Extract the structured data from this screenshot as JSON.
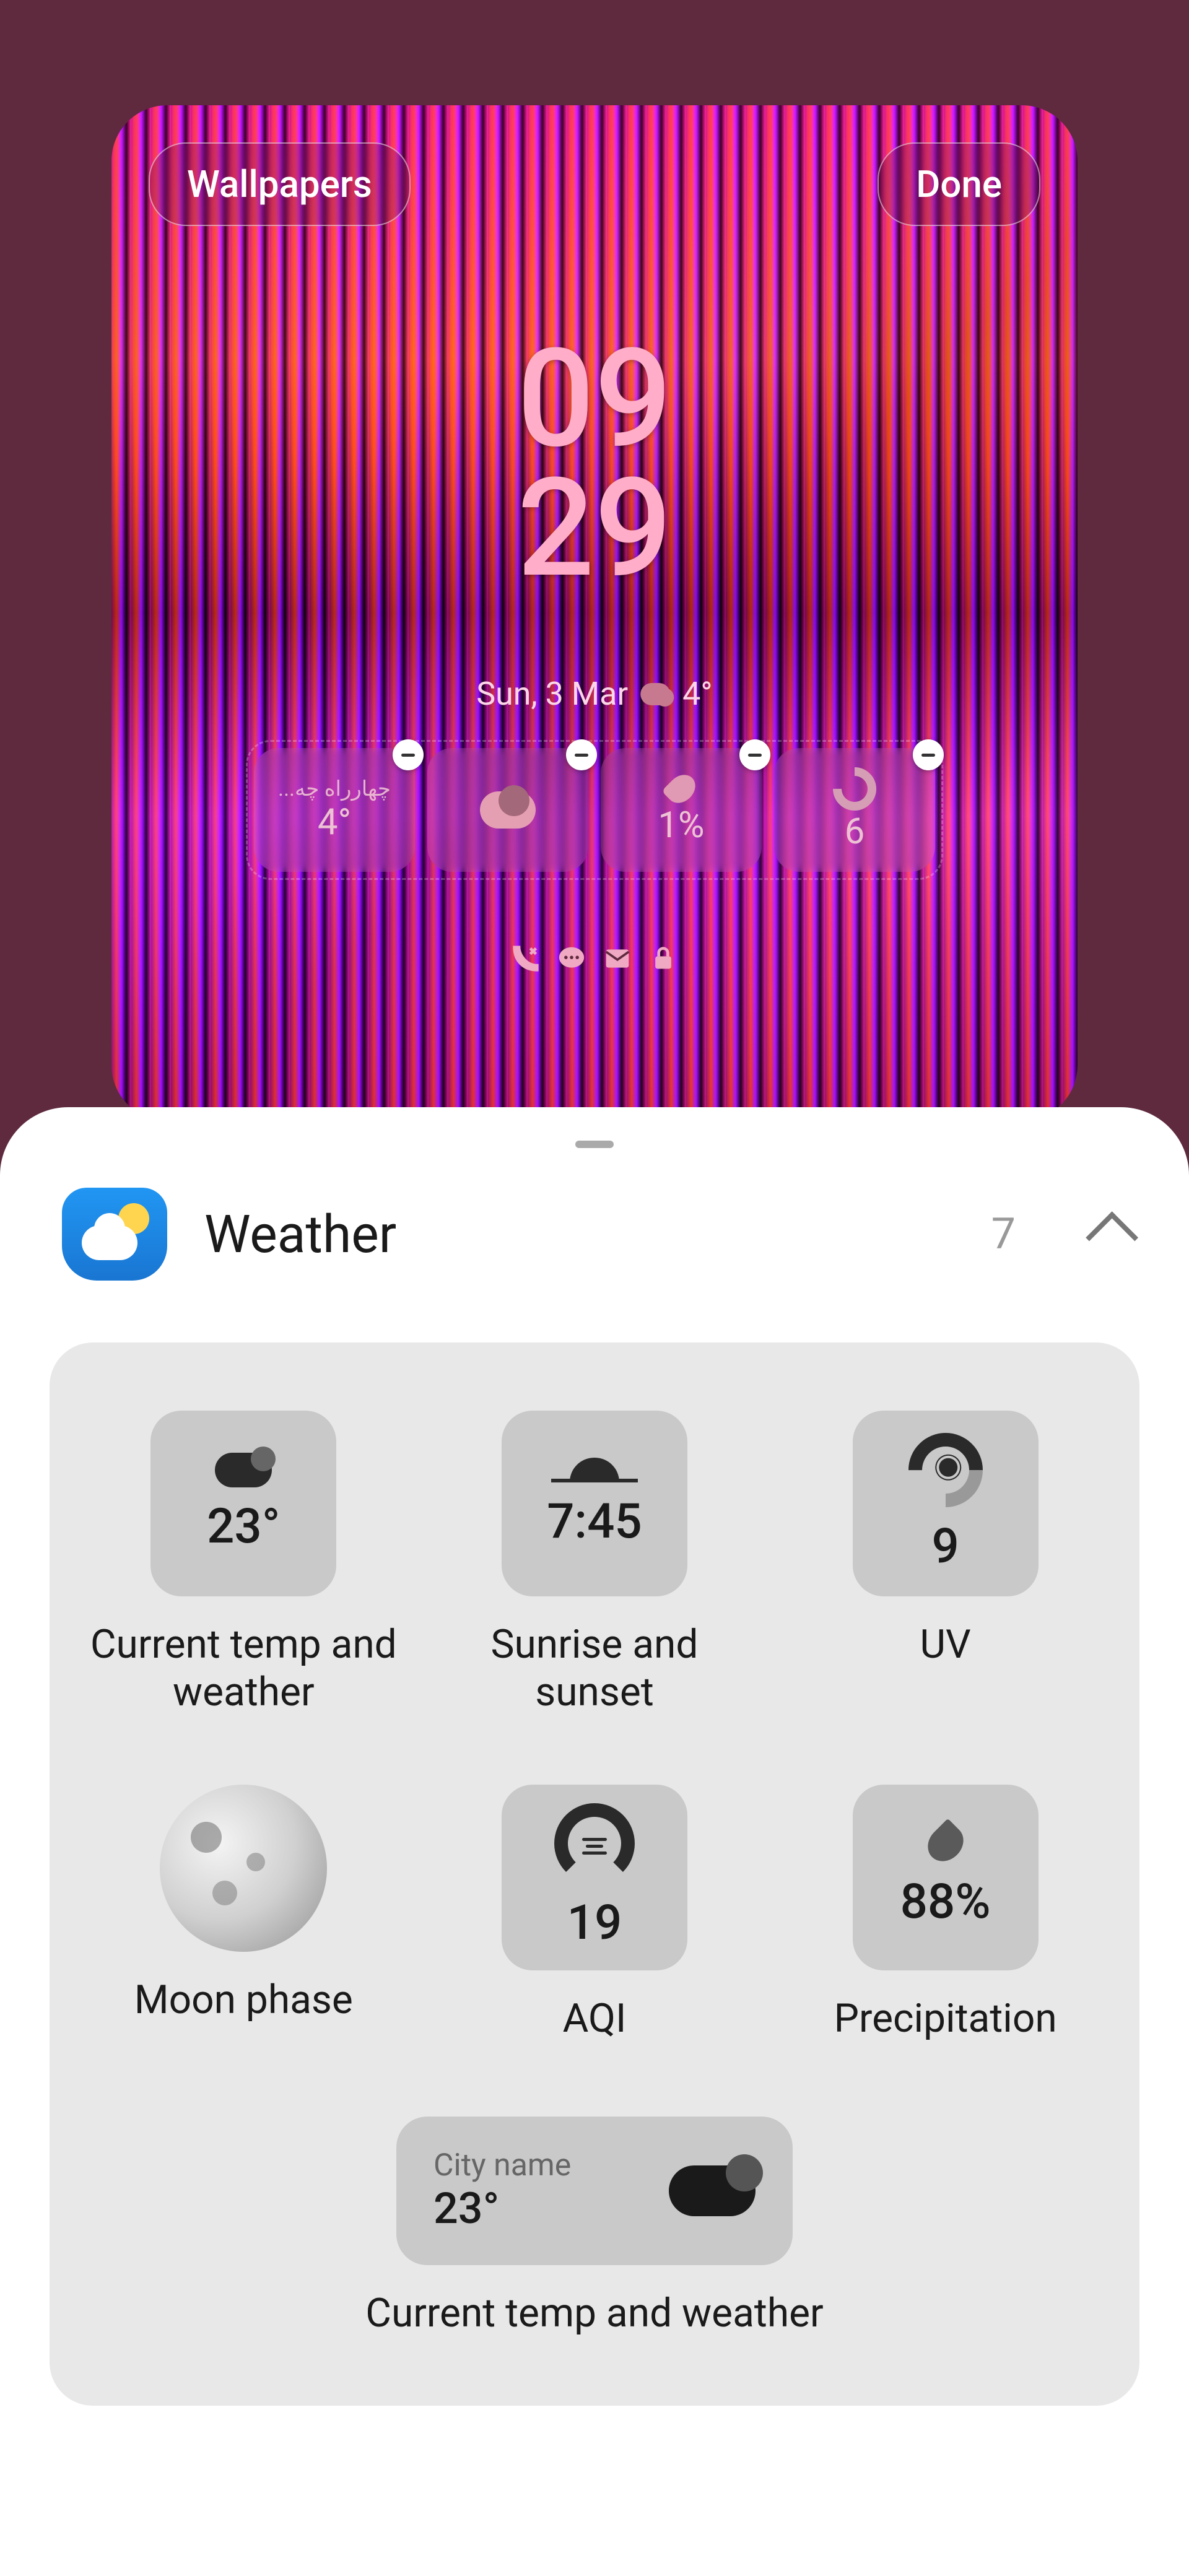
{
  "topButtons": {
    "wallpapers": "Wallpapers",
    "done": "Done"
  },
  "lockscreen": {
    "clockH": "09",
    "clockM": "29",
    "date": "Sun, 3 Mar",
    "temp": "4°",
    "widgets": {
      "w1_top": "...چهارراه چه",
      "w1_val": "4°",
      "w3_val": "1%",
      "w4_val": "6"
    }
  },
  "sheet": {
    "title": "Weather",
    "count": "7"
  },
  "widgets": {
    "currentTemp": {
      "value": "23°",
      "label": "Current temp and weather"
    },
    "sunrise": {
      "value": "7:45",
      "label": "Sunrise and sunset"
    },
    "uv": {
      "value": "9",
      "label": "UV"
    },
    "moon": {
      "label": "Moon phase"
    },
    "aqi": {
      "value": "19",
      "label": "AQI"
    },
    "precip": {
      "value": "88%",
      "label": "Precipitation"
    },
    "city": {
      "city": "City name",
      "value": "23°",
      "label": "Current temp and weather"
    }
  }
}
